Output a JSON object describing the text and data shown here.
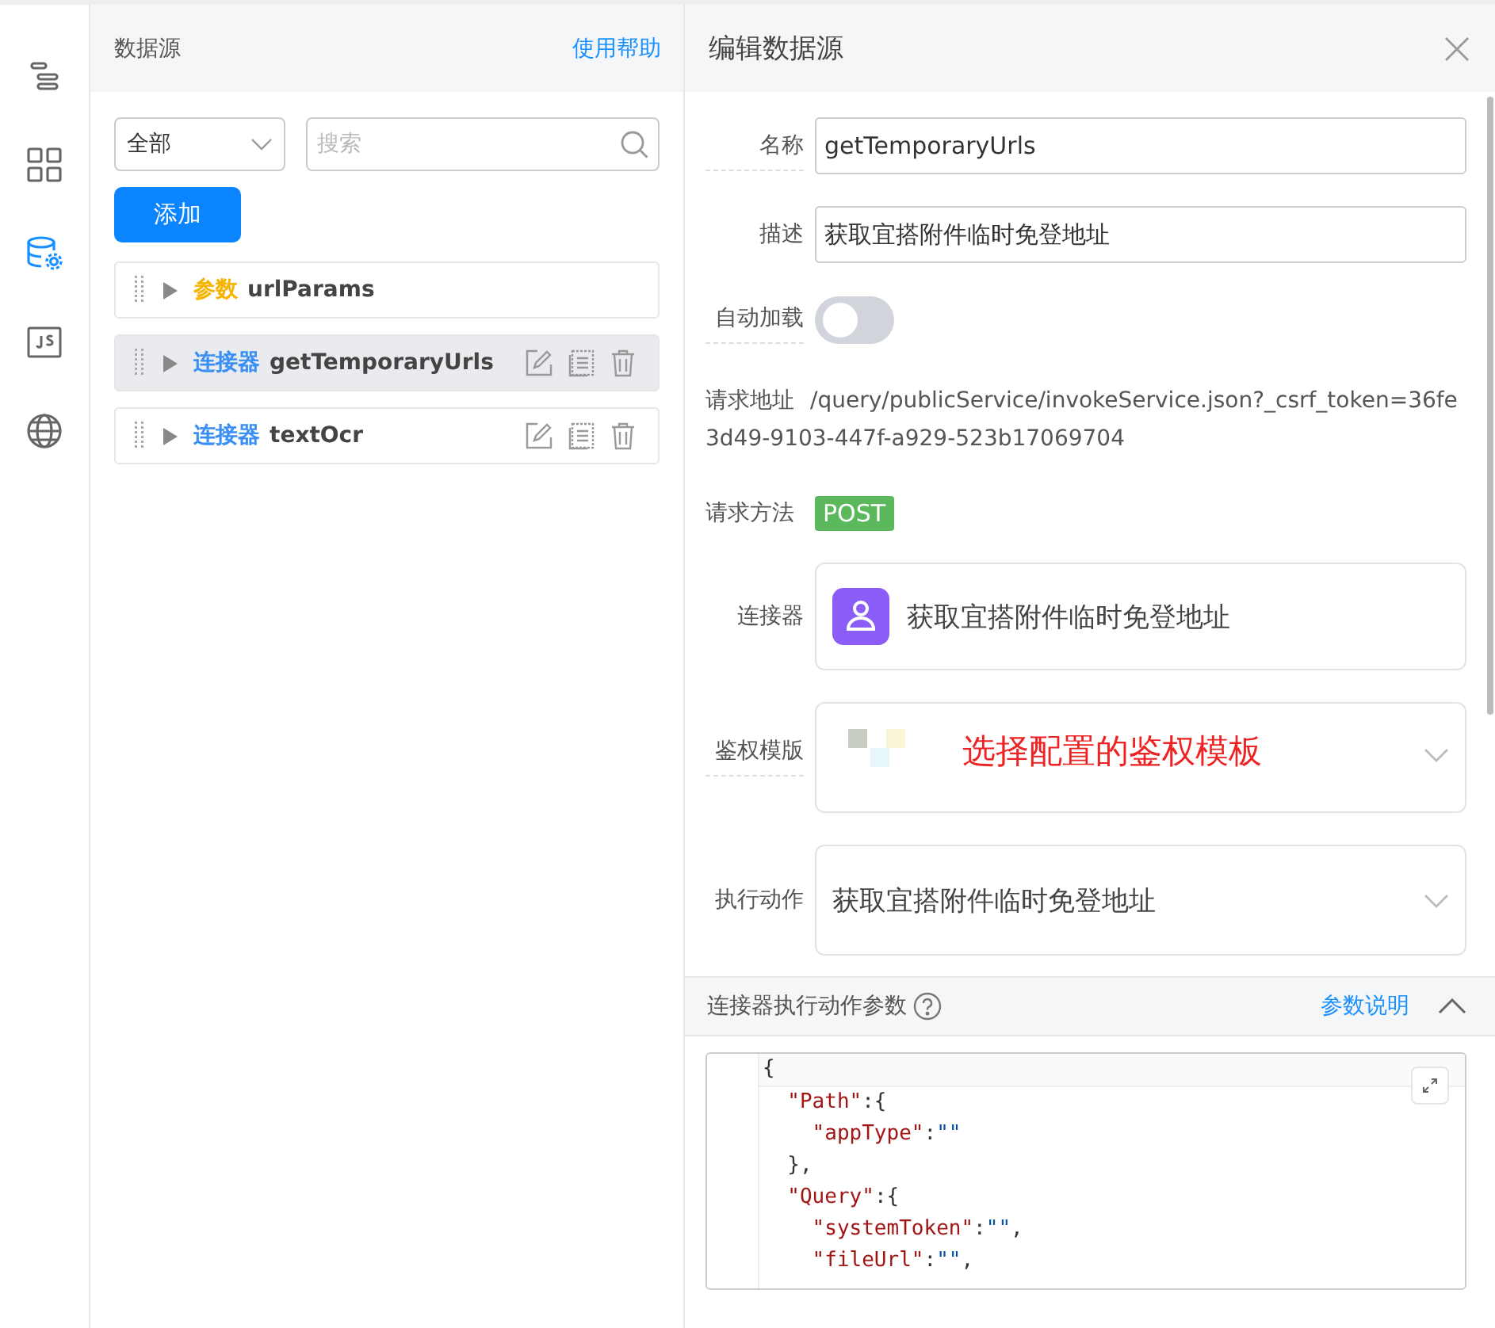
{
  "nav": [
    {
      "selected": false
    },
    {
      "selected": false
    },
    {
      "selected": true
    },
    {
      "selected": false
    },
    {
      "selected": false
    }
  ],
  "datasource": {
    "title": "数据源",
    "help": "使用帮助",
    "filter": "全部",
    "search_placeholder": "搜索",
    "add": "添加",
    "items": [
      {
        "kind": "param",
        "tag": "参数",
        "name": "urlParams",
        "selected": false,
        "actions": false
      },
      {
        "kind": "connector",
        "tag": "连接器",
        "name": "getTemporaryUrls",
        "selected": true,
        "actions": true
      },
      {
        "kind": "connector",
        "tag": "连接器",
        "name": "textOcr",
        "selected": false,
        "actions": true
      }
    ]
  },
  "editor": {
    "title": "编辑数据源",
    "name_label": "名称",
    "name": "getTemporaryUrls",
    "desc_label": "描述",
    "desc": "获取宜搭附件临时免登地址",
    "autoload_label": "自动加载",
    "autoload": false,
    "url_label": "请求地址",
    "url": "/query/publicService/invokeService.json?_csrf_token=36fe3d49-9103-447f-a929-523b17069704",
    "method_label": "请求方法",
    "method": "POST",
    "connector_label": "连接器",
    "connector": "获取宜搭附件临时免登地址",
    "auth_label": "鉴权模版",
    "auth_annotation": "选择配置的鉴权模板",
    "action_label": "执行动作",
    "action": "获取宜搭附件临时免登地址",
    "params_title": "连接器执行动作参数",
    "params_help": "参数说明",
    "params_expanded": true,
    "code": [
      {
        "tokens": [
          {
            "kind": "punct",
            "text": "{"
          }
        ],
        "children": [
          {
            "tokens": [
              {
                "kind": "key",
                "text": "\"Path\""
              },
              {
                "kind": "punct",
                "text": ":{"
              }
            ],
            "children": [
              {
                "tokens": [
                  {
                    "kind": "key",
                    "text": "\"appType\""
                  },
                  {
                    "kind": "punct",
                    "text": ":"
                  },
                  {
                    "kind": "str",
                    "text": "\"\""
                  }
                ]
              }
            ]
          },
          {
            "tokens": [
              {
                "kind": "punct",
                "text": "},"
              }
            ]
          },
          {
            "tokens": [
              {
                "kind": "key",
                "text": "\"Query\""
              },
              {
                "kind": "punct",
                "text": ":{"
              }
            ],
            "children": [
              {
                "tokens": [
                  {
                    "kind": "key",
                    "text": "\"systemToken\""
                  },
                  {
                    "kind": "punct",
                    "text": ":"
                  },
                  {
                    "kind": "str",
                    "text": "\"\""
                  },
                  {
                    "kind": "punct",
                    "text": ","
                  }
                ]
              },
              {
                "tokens": [
                  {
                    "kind": "key",
                    "text": "\"fileUrl\""
                  },
                  {
                    "kind": "punct",
                    "text": ":"
                  },
                  {
                    "kind": "str",
                    "text": "\"\""
                  },
                  {
                    "kind": "punct",
                    "text": ","
                  }
                ]
              }
            ]
          }
        ]
      }
    ]
  }
}
